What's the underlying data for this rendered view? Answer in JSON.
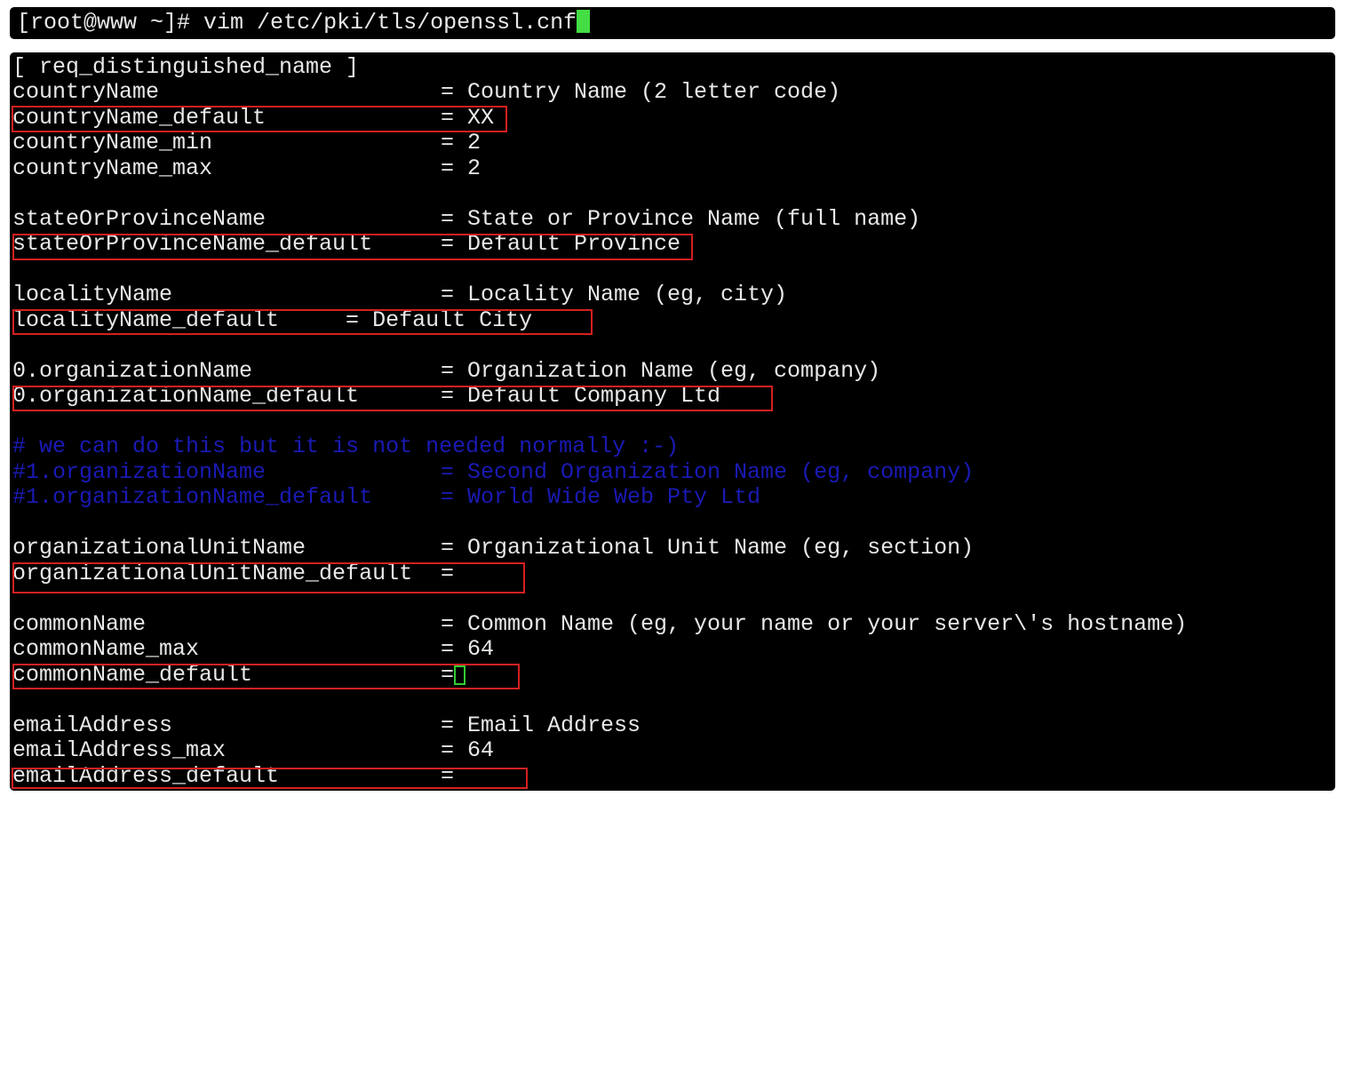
{
  "shell": {
    "prompt": "[root@www ~]# ",
    "command": "vim /etc/pki/tls/openssl.cnf"
  },
  "editor": {
    "lines": [
      {
        "key": "[ req_distinguished_name ]",
        "eq": "",
        "value": ""
      },
      {
        "key": "countryName",
        "eq": "=",
        "value": "Country Name (2 letter code)"
      },
      {
        "key": "countryName_default",
        "eq": "=",
        "value": "XX"
      },
      {
        "key": "countryName_min",
        "eq": "=",
        "value": "2"
      },
      {
        "key": "countryName_max",
        "eq": "=",
        "value": "2"
      },
      {
        "key": "",
        "eq": "",
        "value": ""
      },
      {
        "key": "stateOrProvinceName",
        "eq": "=",
        "value": "State or Province Name (full name)"
      },
      {
        "key": "stateOrProvinceName_default",
        "eq": "=",
        "value": "Default Province"
      },
      {
        "key": "",
        "eq": "",
        "value": ""
      },
      {
        "key": "localityName",
        "eq": "=",
        "value": "Locality Name (eg, city)"
      },
      {
        "key": "localityName_default     = Default City",
        "eq": "",
        "value": ""
      },
      {
        "key": "",
        "eq": "",
        "value": ""
      },
      {
        "key": "0.organizationName",
        "eq": "=",
        "value": "Organization Name (eg, company)"
      },
      {
        "key": "0.organizationName_default",
        "eq": "=",
        "value": "Default Company Ltd"
      },
      {
        "key": "",
        "eq": "",
        "value": ""
      },
      {
        "key": "# we can do this but it is not needed normally :-)",
        "eq": "",
        "value": ""
      },
      {
        "key": "#1.organizationName",
        "eq": "=",
        "value": "Second Organization Name (eg, company)"
      },
      {
        "key": "#1.organizationName_default",
        "eq": "=",
        "value": "World Wide Web Pty Ltd"
      },
      {
        "key": "",
        "eq": "",
        "value": ""
      },
      {
        "key": "organizationalUnitName",
        "eq": "=",
        "value": "Organizational Unit Name (eg, section)"
      },
      {
        "key": "organizationalUnitName_default",
        "eq": "=",
        "value": ""
      },
      {
        "key": "",
        "eq": "",
        "value": ""
      },
      {
        "key": "commonName",
        "eq": "=",
        "value": "Common Name (eg, your name or your server\\'s hostname)"
      },
      {
        "key": "commonName_max",
        "eq": "=",
        "value": "64"
      },
      {
        "key": "commonName_default",
        "eq": "=",
        "value": ""
      },
      {
        "key": "",
        "eq": "",
        "value": ""
      },
      {
        "key": "emailAddress",
        "eq": "=",
        "value": "Email Address"
      },
      {
        "key": "emailAddress_max",
        "eq": "=",
        "value": "64"
      },
      {
        "key": "emailAddress_default",
        "eq": "=",
        "value": ""
      }
    ]
  },
  "colors": {
    "terminal_bg": "#000000",
    "text": "#e8e8e8",
    "comment": "#1a1ab4",
    "highlight_box": "#d42020",
    "cursor": "#44dd44"
  }
}
